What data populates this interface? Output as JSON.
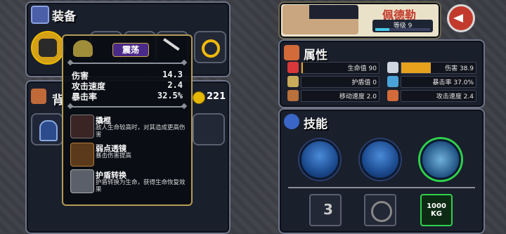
{
  "equipment": {
    "title": "装备",
    "tooltip": {
      "tag": "震荡",
      "stats": [
        {
          "label": "伤害",
          "value": "14.3"
        },
        {
          "label": "攻击速度",
          "value": "2.4"
        },
        {
          "label": "暴击率",
          "value": "32.5%"
        }
      ],
      "perks": [
        {
          "name": "撬棍",
          "desc": "敌人生命较高时，对其造成更高伤害"
        },
        {
          "name": "弱点透镜",
          "desc": "暴击伤害提高"
        },
        {
          "name": "护盾转换",
          "desc": "护盾转换为生命，获得生命恢复效果"
        }
      ]
    }
  },
  "backpack": {
    "title": "背",
    "coins": "221"
  },
  "hero": {
    "name": "佩德勒",
    "level_label": "等级 9",
    "xp_fraction": 0.25
  },
  "attributes": {
    "title": "属性",
    "items": [
      {
        "key": "hp",
        "label": "生命值 90",
        "fill": 0.02,
        "icon": "heart-icon",
        "color": "#d9383a"
      },
      {
        "key": "dmg",
        "label": "伤害 38.9",
        "fill": 0.4,
        "icon": "sword-icon",
        "color": "#cfd6e0"
      },
      {
        "key": "shield",
        "label": "护盾值 0",
        "fill": 0,
        "icon": "shield-icon",
        "color": "#c9ab5c"
      },
      {
        "key": "crit",
        "label": "暴击率 37.0%",
        "fill": 0,
        "icon": "eye-icon",
        "color": "#4aa3d8"
      },
      {
        "key": "move",
        "label": "移动速度 2.0",
        "fill": 0,
        "icon": "boot-icon",
        "color": "#b8703c"
      },
      {
        "key": "atkspd",
        "label": "攻击速度 2.4",
        "fill": 0,
        "icon": "fist-icon",
        "color": "#d26a3a"
      }
    ]
  },
  "skills": {
    "title": "技能",
    "bottom": {
      "multiplier": "3",
      "weight": "1000 KG"
    }
  },
  "colors": {
    "accent": "#e6a21c",
    "panel": "#1a1f2c",
    "tooltip_border": "#b59b55"
  }
}
